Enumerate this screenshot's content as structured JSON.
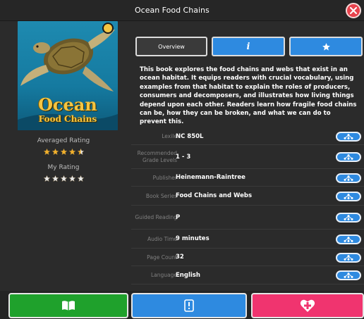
{
  "header": {
    "title": "Ocean Food Chains"
  },
  "book": {
    "cover_title_line1": "Ocean",
    "cover_title_line2": "Food Chains",
    "averaged_rating_label": "Averaged Rating",
    "averaged_rating": 4.5,
    "my_rating_label": "My Rating",
    "my_rating": 0
  },
  "tabs": [
    {
      "label": "Overview",
      "selected": true
    },
    {
      "label": "",
      "icon": "info-icon",
      "selected": false
    },
    {
      "label": "",
      "icon": "star-icon",
      "selected": false
    }
  ],
  "description": "This book explores the food chains and webs that exist in an ocean habitat. It equips readers with crucial vocabulary, using examples from that habitat to explain the roles of producers, consumers and decomposers, and illustrates how living things depend upon each other. Readers learn how fragile food chains can be, how they can be broken, and what we can do to prevent this.",
  "details": [
    {
      "label": "Lexile",
      "value": "NC 850L"
    },
    {
      "label": "Recommended Grade Levels",
      "value": "1 - 3"
    },
    {
      "label": "Publisher",
      "value": "Heinemann-Raintree"
    },
    {
      "label": "Book Series",
      "value": "Food Chains and Webs"
    },
    {
      "label": "Guided Reading",
      "value": "P"
    },
    {
      "label": "Audio Time",
      "value": "9 minutes"
    },
    {
      "label": "Page Count",
      "value": "32"
    },
    {
      "label": "Language",
      "value": "English"
    }
  ],
  "colors": {
    "accent_blue": "#2e8ae0",
    "read_green": "#1fa12c",
    "wish_pink": "#f0346f",
    "close_red": "#e8434d",
    "star_gold": "#f2b02a"
  },
  "footer": {
    "buttons": [
      {
        "icon": "open-book-icon"
      },
      {
        "icon": "info-tablet-icon"
      },
      {
        "icon": "heart-plus-icon"
      }
    ]
  }
}
